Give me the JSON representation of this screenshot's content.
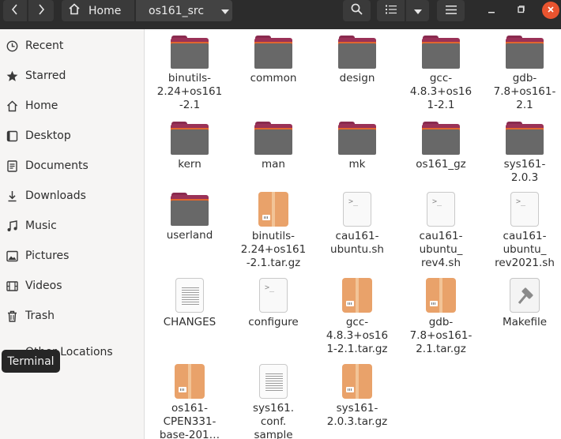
{
  "header": {
    "back_icon": "chevron-left-icon",
    "forward_icon": "chevron-right-icon",
    "breadcrumb": {
      "home_label": "Home",
      "current_label": "os161_src"
    },
    "search_icon": "search-icon",
    "view_icon": "list-view-icon",
    "view_dropdown_icon": "chevron-down-icon",
    "menu_icon": "hamburger-menu-icon",
    "window": {
      "minimize_icon": "minimize-icon",
      "maximize_icon": "maximize-icon",
      "close_icon": "close-icon"
    },
    "close_color": "#E9542F"
  },
  "sidebar": {
    "items": [
      {
        "label": "Recent",
        "icon": "clock-icon"
      },
      {
        "label": "Starred",
        "icon": "star-icon"
      },
      {
        "label": "Home",
        "icon": "home-icon"
      },
      {
        "label": "Desktop",
        "icon": "desktop-icon"
      },
      {
        "label": "Documents",
        "icon": "documents-icon"
      },
      {
        "label": "Downloads",
        "icon": "download-icon"
      },
      {
        "label": "Music",
        "icon": "music-icon"
      },
      {
        "label": "Pictures",
        "icon": "pictures-icon"
      },
      {
        "label": "Videos",
        "icon": "video-icon"
      },
      {
        "label": "Trash",
        "icon": "trash-icon"
      }
    ],
    "other_locations": {
      "label": "Other Locations",
      "icon": "plus-icon"
    }
  },
  "tooltip": {
    "label": "Terminal"
  },
  "files": [
    {
      "lines": [
        "binutils-",
        "2.24+os161",
        "-2.1"
      ],
      "type": "folder"
    },
    {
      "lines": [
        "common"
      ],
      "type": "folder"
    },
    {
      "lines": [
        "design"
      ],
      "type": "folder"
    },
    {
      "lines": [
        "gcc-",
        "4.8.3+os16",
        "1-2.1"
      ],
      "type": "folder"
    },
    {
      "lines": [
        "gdb-",
        "7.8+os161-",
        "2.1"
      ],
      "type": "folder"
    },
    {
      "lines": [
        "kern"
      ],
      "type": "folder"
    },
    {
      "lines": [
        "man"
      ],
      "type": "folder"
    },
    {
      "lines": [
        "mk"
      ],
      "type": "folder"
    },
    {
      "lines": [
        "os161_gz"
      ],
      "type": "folder"
    },
    {
      "lines": [
        "sys161-",
        "2.0.3"
      ],
      "type": "folder"
    },
    {
      "lines": [
        "userland"
      ],
      "type": "folder"
    },
    {
      "lines": [
        "binutils-",
        "2.24+os161",
        "-2.1.tar.gz"
      ],
      "type": "archive"
    },
    {
      "lines": [
        "cau161-",
        "ubuntu.sh"
      ],
      "type": "script"
    },
    {
      "lines": [
        "cau161-",
        "ubuntu_",
        "rev4.sh"
      ],
      "type": "script"
    },
    {
      "lines": [
        "cau161-",
        "ubuntu_",
        "rev2021.sh"
      ],
      "type": "script"
    },
    {
      "lines": [
        "CHANGES"
      ],
      "type": "text"
    },
    {
      "lines": [
        "configure"
      ],
      "type": "script"
    },
    {
      "lines": [
        "gcc-",
        "4.8.3+os16",
        "1-2.1.tar.gz"
      ],
      "type": "archive"
    },
    {
      "lines": [
        "gdb-",
        "7.8+os161-",
        "2.1.tar.gz"
      ],
      "type": "archive"
    },
    {
      "lines": [
        "Makefile"
      ],
      "type": "makefile"
    },
    {
      "lines": [
        "os161-",
        "CPEN331-",
        "base-201…"
      ],
      "type": "archive"
    },
    {
      "lines": [
        "sys161.",
        "conf.",
        "sample"
      ],
      "type": "text"
    },
    {
      "lines": [
        "sys161-",
        "2.0.3.tar.gz"
      ],
      "type": "archive"
    }
  ]
}
